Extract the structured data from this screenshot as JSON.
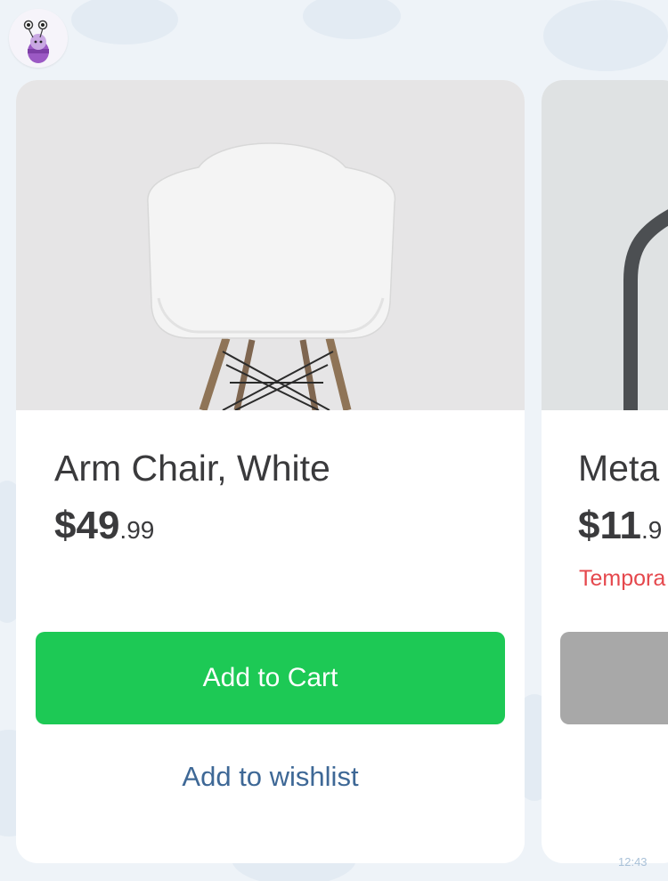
{
  "products": [
    {
      "title": "Arm Chair, White",
      "price_whole": "$49",
      "price_cents": ".99",
      "status": "",
      "cart_label": "Add to Cart",
      "wishlist_label": "Add to wishlist"
    },
    {
      "title": "Meta",
      "price_whole": "$11",
      "price_cents": ".9",
      "status": "Tempora",
      "cart_label": "",
      "wishlist_label": ""
    }
  ],
  "timestamp": "12:43",
  "colors": {
    "add_to_cart": "#1dc955",
    "add_to_cart_disabled": "#a8a8a8",
    "wishlist_link": "#3e6896",
    "status_text": "#e5484d",
    "text": "#3a3a3c",
    "background": "#eef3f8"
  }
}
